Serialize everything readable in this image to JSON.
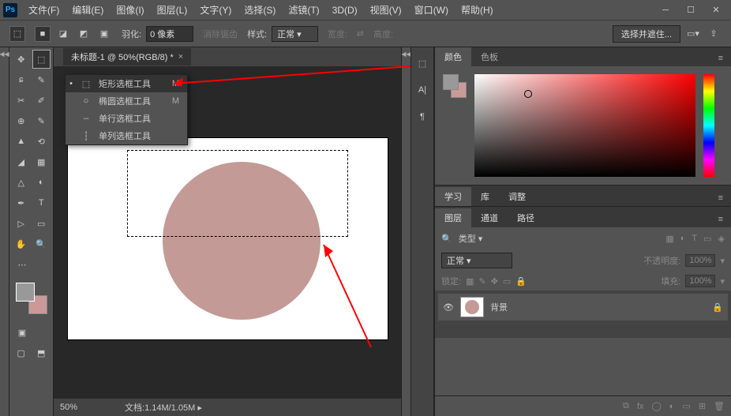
{
  "menu": {
    "items": [
      "文件(F)",
      "编辑(E)",
      "图像(I)",
      "图层(L)",
      "文字(Y)",
      "选择(S)",
      "滤镜(T)",
      "3D(D)",
      "视图(V)",
      "窗口(W)",
      "帮助(H)"
    ]
  },
  "options": {
    "feather_label": "羽化:",
    "feather_value": "0 像素",
    "antialias": "消除锯齿",
    "style_label": "样式:",
    "style_value": "正常",
    "width_label": "宽度:",
    "height_label": "高度:",
    "mask_btn": "选择并遮住..."
  },
  "doc": {
    "tab_title": "未标题-1 @ 50%(RGB/8) *",
    "zoom": "50%",
    "file_info": "文档:",
    "file_size": "1.14M/1.05M"
  },
  "flyout": {
    "items": [
      {
        "icon": "⬚",
        "label": "矩形选框工具",
        "key": "M",
        "sel": true
      },
      {
        "icon": "○",
        "label": "椭圆选框工具",
        "key": "M",
        "sel": false
      },
      {
        "icon": "┄",
        "label": "单行选框工具",
        "key": "",
        "sel": false
      },
      {
        "icon": "┆",
        "label": "单列选框工具",
        "key": "",
        "sel": false
      }
    ]
  },
  "panels": {
    "color_tabs": [
      "颜色",
      "色板"
    ],
    "color_active": "颜色",
    "mid_tabs": [
      "学习",
      "库",
      "调整"
    ],
    "layer_tabs": [
      "图层",
      "通道",
      "路径"
    ],
    "layer_active": "图层",
    "kind": "类型",
    "blend": "正常",
    "opacity_label": "不透明度:",
    "opacity": "100%",
    "lock_label": "锁定:",
    "fill_label": "填充:",
    "fill": "100%",
    "layer_name": "背景"
  },
  "colors": {
    "fg": "#999999",
    "bg": "#cc9999",
    "circle": "#c49a96"
  }
}
